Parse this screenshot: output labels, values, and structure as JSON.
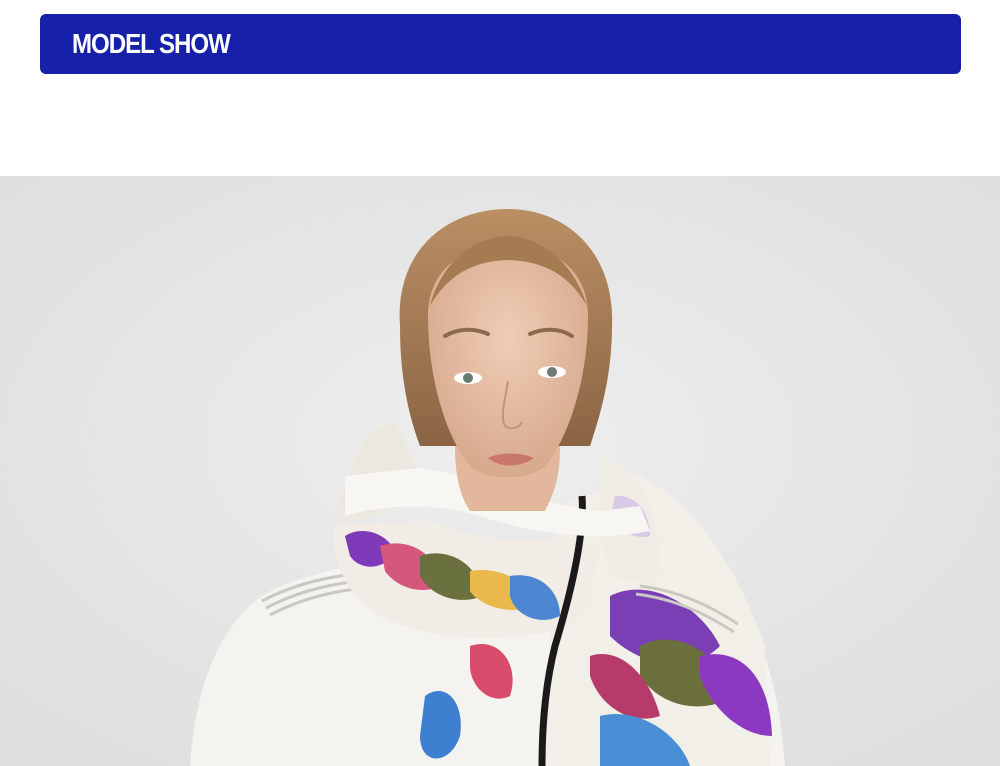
{
  "header": {
    "title": "MODEL SHOW"
  },
  "colors": {
    "banner": "#1720a8",
    "photo_background": "#e7e7e7"
  },
  "photo": {
    "subject": "model-wearing-floral-ski-jacket"
  }
}
